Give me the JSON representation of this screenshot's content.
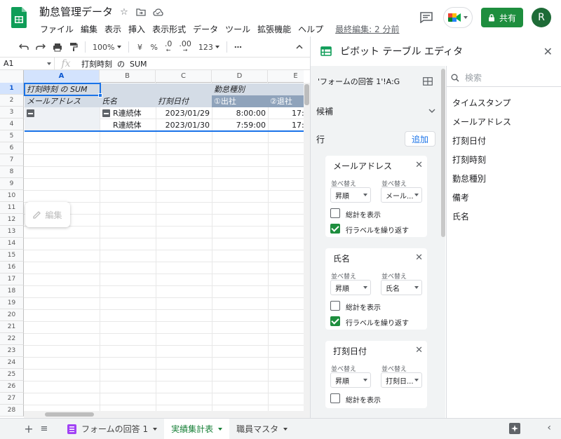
{
  "header": {
    "title": "勤怠管理データ",
    "menu": [
      "ファイル",
      "編集",
      "表示",
      "挿入",
      "表示形式",
      "データ",
      "ツール",
      "拡張機能",
      "ヘルプ"
    ],
    "last_edit": "最終編集: 2 分前",
    "share_label": "共有",
    "avatar_initial": "R"
  },
  "toolbar": {
    "zoom": "100%",
    "currency": "¥",
    "percent": "%",
    "dec_decrease": ".0",
    "dec_increase": ".00",
    "format_more": "123",
    "more": "⋯"
  },
  "formula_bar": {
    "name_box": "A1",
    "fx": "fx",
    "content": "打刻時刻  の  SUM"
  },
  "grid": {
    "columns": [
      "A",
      "B",
      "C",
      "D",
      "E"
    ],
    "rows": [
      "1",
      "2",
      "3",
      "4",
      "5",
      "6",
      "7",
      "8",
      "9",
      "10",
      "11",
      "12",
      "13",
      "14",
      "15",
      "16",
      "17",
      "18",
      "19",
      "20",
      "21",
      "22",
      "23",
      "24",
      "25",
      "26",
      "27",
      "28"
    ],
    "cells": {
      "a1": "打刻時刻 の SUM",
      "d1": "勤怠種別",
      "a2": "メールアドレス",
      "b2": "氏名",
      "c2": "打刻日付",
      "d2": "①出社",
      "e2": "②退社",
      "b3": "R連続体",
      "c3": "2023/01/29",
      "d3": "8:00:00",
      "e3": "17:",
      "b4": "R連続体",
      "c4": "2023/01/30",
      "d4": "7:59:00",
      "e4": "17:"
    },
    "edit_chip": "編集"
  },
  "pivot_editor": {
    "title": "ピボット テーブル エディタ",
    "range": "'フォームの回答 1'!A:G",
    "candidates": "候補",
    "rows_label": "行",
    "add_label": "追加",
    "cards": [
      {
        "title": "メールアドレス",
        "sort_label": "並べ替え",
        "sort_by_label": "並べ替え",
        "order": "昇順",
        "by": "メール...",
        "show_totals": "総計を表示",
        "repeat_labels": "行ラベルを繰り返す",
        "totals_checked": false,
        "repeat_checked": true
      },
      {
        "title": "氏名",
        "sort_label": "並べ替え",
        "sort_by_label": "並べ替え",
        "order": "昇順",
        "by": "氏名",
        "show_totals": "総計を表示",
        "repeat_labels": "行ラベルを繰り返す",
        "totals_checked": false,
        "repeat_checked": true
      },
      {
        "title": "打刻日付",
        "sort_label": "並べ替え",
        "sort_by_label": "並べ替え",
        "order": "昇順",
        "by": "打刻日...",
        "show_totals": "総計を表示",
        "totals_checked": false
      }
    ],
    "search_placeholder": "検索",
    "fields": [
      "タイムスタンプ",
      "メールアドレス",
      "打刻日付",
      "打刻時刻",
      "勤怠種別",
      "備考",
      "氏名"
    ]
  },
  "bottom_tabs": {
    "tabs": [
      "フォームの回答 1",
      "実績集計表",
      "職員マスタ"
    ],
    "active": "実績集計表"
  },
  "colors": {
    "accent": "#1a73e8",
    "share_green": "#1e8e3e",
    "pivot_header": "#d4dce6",
    "pivot_header_dark": "#8fa3bb",
    "sheets_green": "#0f9d58"
  }
}
